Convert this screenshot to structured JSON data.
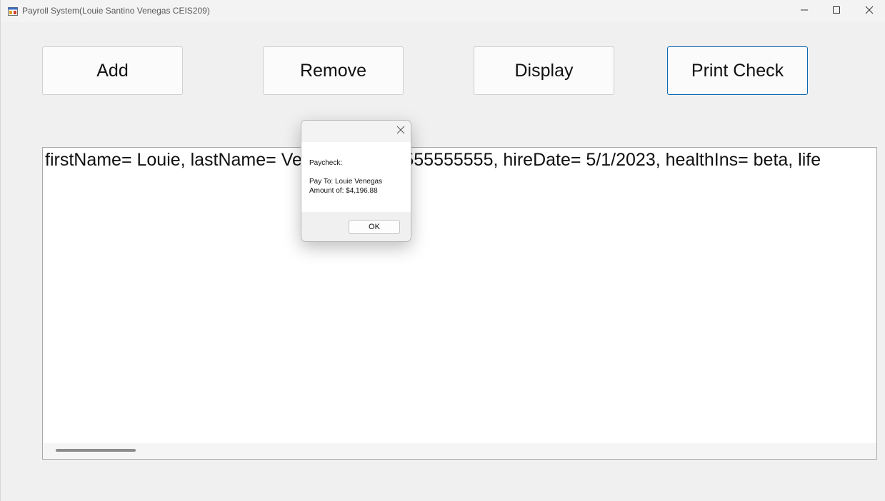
{
  "window": {
    "title": "Payroll System(Louie Santino Venegas CEIS209)"
  },
  "buttons": {
    "add": "Add",
    "remove": "Remove",
    "display": "Display",
    "print_check": "Print Check"
  },
  "output": {
    "line": "firstName= Louie, lastName= Venegas, ssn= 555555555, hireDate= 5/1/2023, healthIns= beta, life"
  },
  "dialog": {
    "heading": "Paycheck:",
    "pay_to": "Pay To: Louie Venegas",
    "amount": "Amount of: $4,196.88",
    "ok_label": "OK"
  },
  "colors": {
    "focus_border": "#0a67b0",
    "window_bg": "#f0f0f0"
  },
  "icons": {
    "app": "app-window-icon",
    "minimize": "minimize-icon",
    "maximize": "maximize-icon",
    "close": "close-icon"
  }
}
